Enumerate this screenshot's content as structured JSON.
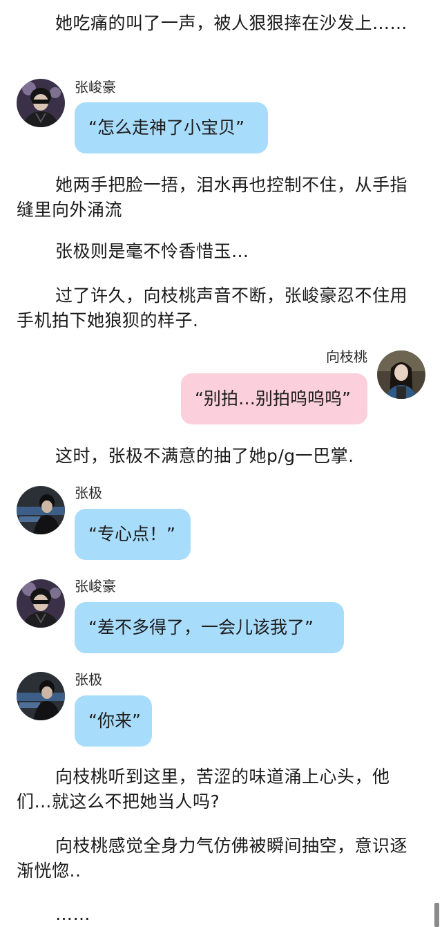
{
  "paragraphs": {
    "p1": "她吃痛的叫了一声，被人狠狠摔在沙发上……",
    "p2": "她两手把脸一捂，泪水再也控制不住，从手指缝里向外涌流",
    "p3": "张极则是毫不怜香惜玉…",
    "p4": "过了许久，向枝桃声音不断，张峻豪忍不住用手机拍下她狼狈的样子.",
    "p5": "这时，张极不满意的抽了她p/g一巴掌.",
    "p6": "向枝桃听到这里，苦涩的味道涌上心头，他们…就这么不把她当人吗?",
    "p7": "向枝桃感觉全身力气仿佛被瞬间抽空，意识逐渐恍惚..",
    "p8": "……"
  },
  "messages": [
    {
      "speaker": "张峻豪",
      "text": "“怎么走神了小宝贝”",
      "side": "left",
      "color": "#a8dcfb"
    },
    {
      "speaker": "向枝桃",
      "text": "“别拍…别拍呜呜呜”",
      "side": "right",
      "color": "#fbd0dc"
    },
    {
      "speaker": "张极",
      "text": "“专心点！”",
      "side": "left",
      "color": "#a8dcfb"
    },
    {
      "speaker": "张峻豪",
      "text": "“差不多得了，一会儿该我了”",
      "side": "left",
      "color": "#a8dcfb"
    },
    {
      "speaker": "张极",
      "text": "“你来”",
      "side": "left",
      "color": "#a8dcfb"
    }
  ],
  "icons": {
    "avatar_1": "avatar-zhangjunhao",
    "avatar_2": "avatar-xiangzhitao",
    "avatar_3": "avatar-zhangji",
    "scrollbar": "scroll-thumb"
  }
}
